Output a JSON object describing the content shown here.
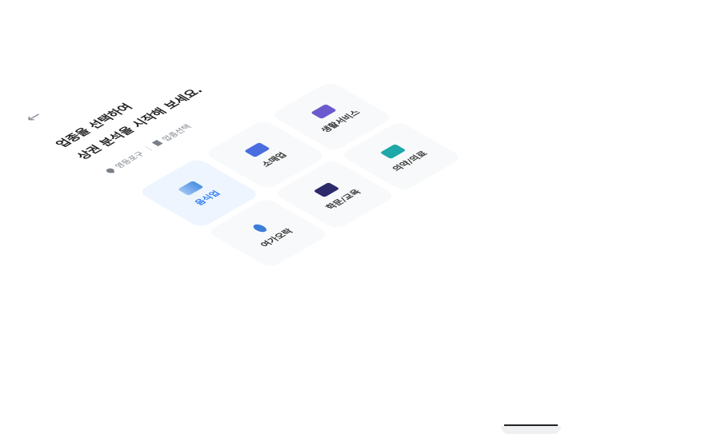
{
  "header": {
    "back_icon": "arrow-left-icon",
    "title_line1": "업종을 선택하여",
    "title_line2": "상권 분석을 시작해 보세요.",
    "location": "영등포구",
    "step": "업종선택"
  },
  "categories": [
    {
      "label": "음식업",
      "icon": "fork-knife-icon",
      "selected": true,
      "color": "#4a90e2"
    },
    {
      "label": "소매업",
      "icon": "wallet-icon",
      "selected": false,
      "color": "#4a6ee0"
    },
    {
      "label": "생활서비스",
      "icon": "service-icon",
      "selected": false,
      "color": "#6a5acd"
    },
    {
      "label": "여가오락",
      "icon": "microphone-icon",
      "selected": false,
      "color": "#3b7dd8"
    },
    {
      "label": "학문/교육",
      "icon": "graduation-cap-icon",
      "selected": false,
      "color": "#2c2a6b"
    },
    {
      "label": "의약/의료",
      "icon": "hospital-icon",
      "selected": false,
      "color": "#1fa8a8"
    }
  ],
  "colors": {
    "accent": "#2b7bf3",
    "selected_bg": "#eef5ff",
    "tile_bg": "#f8f9fa"
  }
}
